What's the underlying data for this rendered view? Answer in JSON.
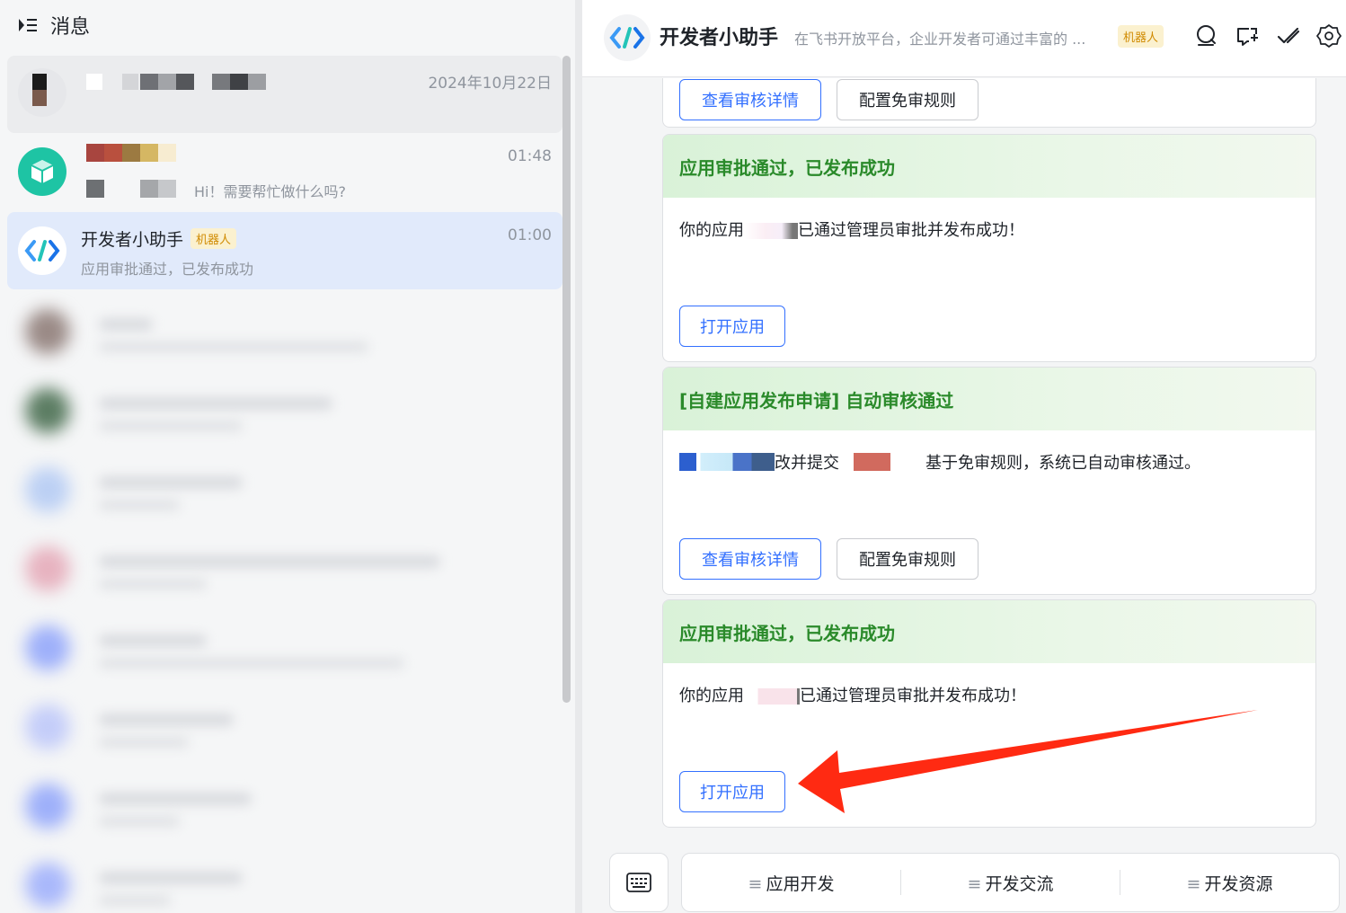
{
  "left": {
    "title": "消息",
    "conversations": [
      {
        "time": "2024年10月22日"
      },
      {
        "time": "01:48",
        "preview": "Hi！需要帮忙做什么吗?"
      },
      {
        "name": "开发者小助手",
        "badge": "机器人",
        "time": "01:00",
        "preview": "应用审批通过，已发布成功"
      }
    ]
  },
  "chat": {
    "title": "开发者小助手",
    "description": "在飞书开放平台，企业开发者可通过丰富的 ...",
    "badge": "机器人",
    "cards": [
      {
        "buttons": [
          "查看审核详情",
          "配置免审规则"
        ]
      },
      {
        "heading": "应用审批通过，已发布成功",
        "body_prefix": "你的应用",
        "body_suffix": "已通过管理员审批并发布成功！",
        "buttons": [
          "打开应用"
        ]
      },
      {
        "heading": "[自建应用发布申请] 自动审核通过",
        "body_mid": "改并提交",
        "body_suffix": "基于免审规则，系统已自动审核通过。",
        "buttons": [
          "查看审核详情",
          "配置免审规则"
        ]
      },
      {
        "heading": "应用审批通过，已发布成功",
        "body_prefix": "你的应用",
        "body_suffix": "已通过管理员审批并发布成功！",
        "buttons": [
          "打开应用"
        ]
      }
    ],
    "menu": [
      {
        "icon": "≡",
        "label": "应用开发"
      },
      {
        "icon": "≡",
        "label": "开发交流"
      },
      {
        "icon": "≡",
        "label": "开发资源"
      }
    ]
  },
  "colors": {
    "accent": "#3370ff",
    "success_heading": "#2a8a2a",
    "bot_badge": "#d08a00",
    "annotation_arrow": "#ff2a12"
  },
  "icons": [
    "menu-icon",
    "search-icon",
    "add-chat-icon",
    "check-icon",
    "settings-icon",
    "keyboard-icon",
    "app-logo-icon",
    "bot-cube-icon"
  ]
}
